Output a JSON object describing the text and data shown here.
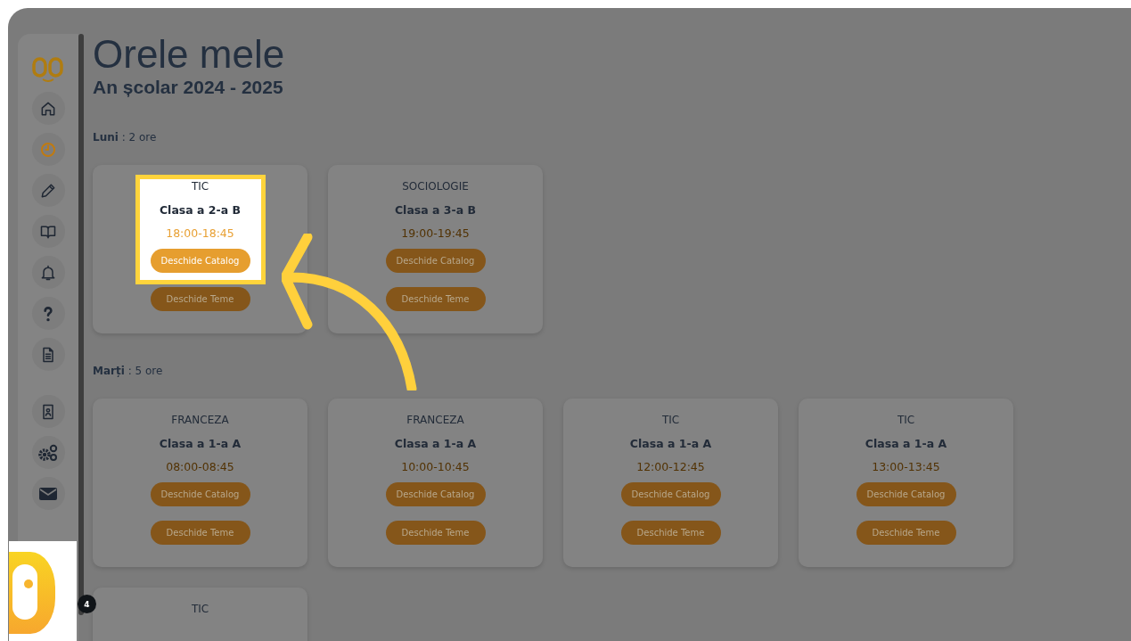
{
  "page": {
    "title": "Orele mele",
    "subtitle": "An școlar 2024 - 2025"
  },
  "sidebar": {
    "items": [
      {
        "kind": "home",
        "selected": false
      },
      {
        "kind": "clock",
        "selected": true
      },
      {
        "kind": "pencil",
        "selected": false
      },
      {
        "kind": "book",
        "selected": false
      },
      {
        "kind": "bell",
        "selected": false
      },
      {
        "kind": "help",
        "selected": false
      },
      {
        "kind": "document",
        "selected": false
      },
      {
        "kind": "contact",
        "selected": false
      },
      {
        "kind": "gears",
        "selected": false
      },
      {
        "kind": "mail",
        "selected": false
      }
    ]
  },
  "days": [
    {
      "label": "**Luni** : 2 ore",
      "lessons": [
        {
          "subject": "TIC",
          "class": "Clasa a 2-a B",
          "time": "18:00-18:45",
          "buttons": [
            "Deschide Catalog",
            "Deschide Teme"
          ],
          "highlighted": true
        },
        {
          "subject": "SOCIOLOGIE",
          "class": "Clasa a 3-a B",
          "time": "19:00-19:45",
          "buttons": [
            "Deschide Catalog",
            "Deschide Teme"
          ],
          "highlighted": false
        }
      ]
    },
    {
      "label": "**Marți** : 5 ore",
      "lessons": [
        {
          "subject": "FRANCEZA",
          "class": "Clasa a 1-a A",
          "time": "08:00-08:45",
          "buttons": [
            "Deschide Catalog",
            "Deschide Teme"
          ],
          "highlighted": false
        },
        {
          "subject": "FRANCEZA",
          "class": "Clasa a 1-a A",
          "time": "10:00-10:45",
          "buttons": [
            "Deschide Catalog",
            "Deschide Teme"
          ],
          "highlighted": false
        },
        {
          "subject": "TIC",
          "class": "Clasa a 1-a A",
          "time": "12:00-12:45",
          "buttons": [
            "Deschide Catalog",
            "Deschide Teme"
          ],
          "highlighted": false
        },
        {
          "subject": "TIC",
          "class": "Clasa a 1-a A",
          "time": "13:00-13:45",
          "buttons": [
            "Deschide Catalog",
            "Deschide Teme"
          ],
          "highlighted": false
        },
        {
          "subject": "TIC",
          "highlighted": false
        }
      ]
    }
  ],
  "help_widget": {
    "badge": "4"
  }
}
